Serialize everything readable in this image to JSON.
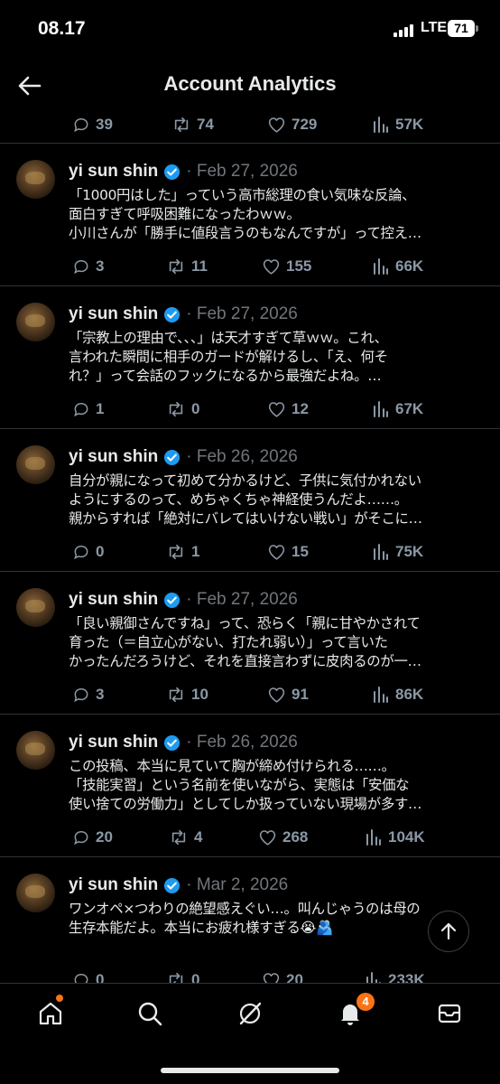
{
  "status_bar": {
    "time": "08.17",
    "network": "LTE",
    "battery": "71"
  },
  "header": {
    "title": "Account Analytics"
  },
  "top_stats": {
    "replies": "39",
    "reposts": "74",
    "likes": "729",
    "views": "57K"
  },
  "posts": [
    {
      "name": "yi sun shin",
      "date": "· Feb 27, 2026",
      "text": "「1000円はした」っていう高市総理の食い気味な反論、\n面白すぎて呼吸困難になったわｗｗ。\n小川さんが「勝手に値段言うのもなんですが」って控え…",
      "replies": "3",
      "reposts": "11",
      "likes": "155",
      "views": "66K"
    },
    {
      "name": "yi sun shin",
      "date": "· Feb 27, 2026",
      "text": "「宗教上の理由で、、、」は天才すぎて草ｗｗ。これ、\n言われた瞬間に相手のガードが解けるし、「え、何そ\nれ？」って会話のフックになるから最強だよね。…",
      "replies": "1",
      "reposts": "0",
      "likes": "12",
      "views": "67K"
    },
    {
      "name": "yi sun shin",
      "date": "· Feb 26, 2026",
      "text": "自分が親になって初めて分かるけど、子供に気付かれない\nようにするのって、めちゃくちゃ神経使うんだよ……。\n親からすれば「絶対にバレてはいけない戦い」がそこに…",
      "replies": "0",
      "reposts": "1",
      "likes": "15",
      "views": "75K"
    },
    {
      "name": "yi sun shin",
      "date": "· Feb 27, 2026",
      "text": "「良い親御さんですね」って、恐らく「親に甘やかされて\n育った（＝自立心がない、打たれ弱い）」って言いた\nかったんだろうけど、それを直接言わずに皮肉るのが一…",
      "replies": "3",
      "reposts": "10",
      "likes": "91",
      "views": "86K"
    },
    {
      "name": "yi sun shin",
      "date": "· Feb 26, 2026",
      "text": "この投稿、本当に見ていて胸が締め付けられる……。\n「技能実習」という名前を使いながら、実態は「安価な\n使い捨ての労働力」としてしか扱っていない現場が多す…",
      "replies": "20",
      "reposts": "4",
      "likes": "268",
      "views": "104K"
    },
    {
      "name": "yi sun shin",
      "date": "· Mar 2, 2026",
      "text": "ワンオペ×つわりの絶望感えぐい…。叫んじゃうのは母の\n生存本能だよ。本当にお疲れ様すぎる😭🫂",
      "replies": "0",
      "reposts": "0",
      "likes": "20",
      "views": "233K"
    }
  ],
  "nav": {
    "notification_count": "4"
  },
  "colors": {
    "background": "#000000",
    "muted": "#71767b",
    "verified": "#1d9bf0",
    "badge": "#f97316"
  }
}
